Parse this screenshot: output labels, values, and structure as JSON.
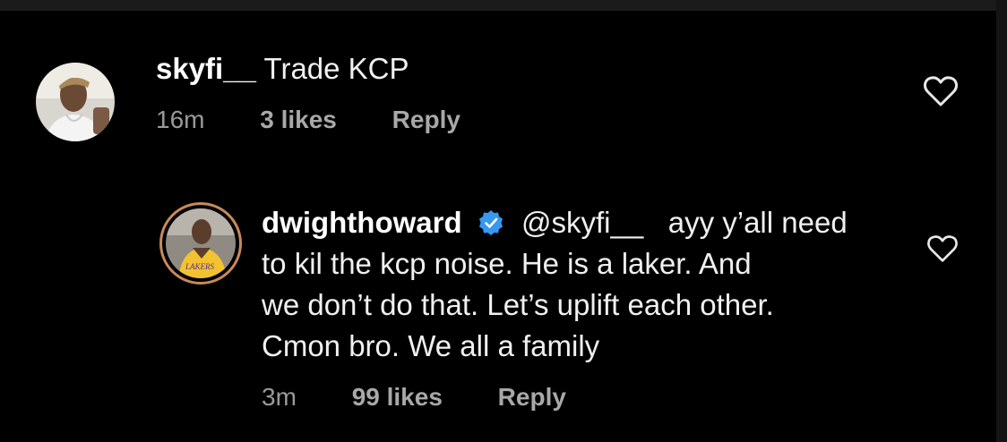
{
  "comments": [
    {
      "username": "skyfi__",
      "text": "Trade KCP",
      "time": "16m",
      "likes": "3 likes",
      "reply_label": "Reply",
      "avatar_icon": "user-avatar-photo",
      "like_icon": "heart-outline-icon"
    },
    {
      "username": "dwighthoward",
      "verified": true,
      "mention": "@skyfi__",
      "text_lines": [
        "ayy y’all need",
        "to kil the kcp noise. He is a laker. And",
        "we don’t do that. Let’s uplift each other.",
        "Cmon bro. We all a family"
      ],
      "time": "3m",
      "likes": "99 likes",
      "reply_label": "Reply",
      "avatar_icon": "user-avatar-photo-story-ring",
      "like_icon": "heart-outline-icon"
    }
  ],
  "colors": {
    "background": "#000000",
    "text": "#f5f5f5",
    "meta": "#9a9a9a",
    "verified_badge": "#3897f0",
    "story_ring": "#c9895a"
  }
}
